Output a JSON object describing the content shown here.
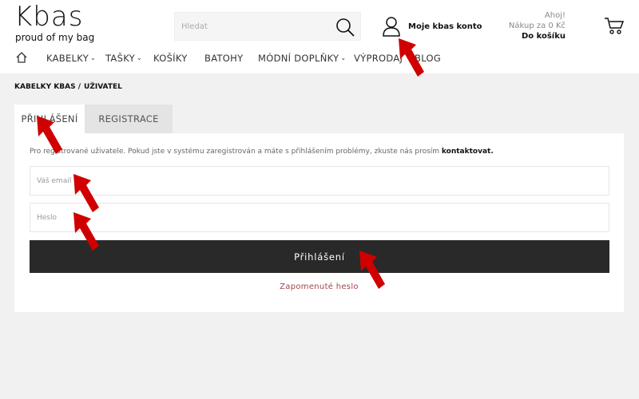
{
  "header": {
    "logo_word": "Kbas",
    "logo_tagline": "proud of my bag",
    "search_placeholder": "Hledat",
    "account_label": "Moje kbas konto",
    "cart_greeting": "Ahoj!",
    "cart_total": "Nákup za 0 Kč",
    "cart_link": "Do košíku"
  },
  "nav": {
    "items": [
      {
        "label": "KABELKY",
        "dropdown": true
      },
      {
        "label": "TAŠKY",
        "dropdown": true
      },
      {
        "label": "KOŠÍKY",
        "dropdown": false
      },
      {
        "label": "BATOHY",
        "dropdown": false
      },
      {
        "label": "MÓDNÍ DOPLŇKY",
        "dropdown": true
      },
      {
        "label": "VÝPRODAJ",
        "dropdown": false
      },
      {
        "label": "BLOG",
        "dropdown": false
      }
    ]
  },
  "breadcrumb": {
    "root": "KABELKY KBAS /",
    "current": "UŽIVATEL"
  },
  "tabs": {
    "login": "PŘIHLÁŠENÍ",
    "register": "REGISTRACE"
  },
  "login": {
    "info_text": "Pro registrované uživatele. Pokud jste v systému zaregistrován a máte s přihlášením problémy, zkuste nás prosím ",
    "info_link": "kontaktovat.",
    "email_placeholder": "Váš email",
    "password_placeholder": "Heslo",
    "submit_label": "Přihlášení",
    "forgot_label": "Zapomenuté heslo"
  },
  "colors": {
    "button_bg": "#292929",
    "link_red": "#a3454b",
    "arrow_red": "#d00000"
  }
}
